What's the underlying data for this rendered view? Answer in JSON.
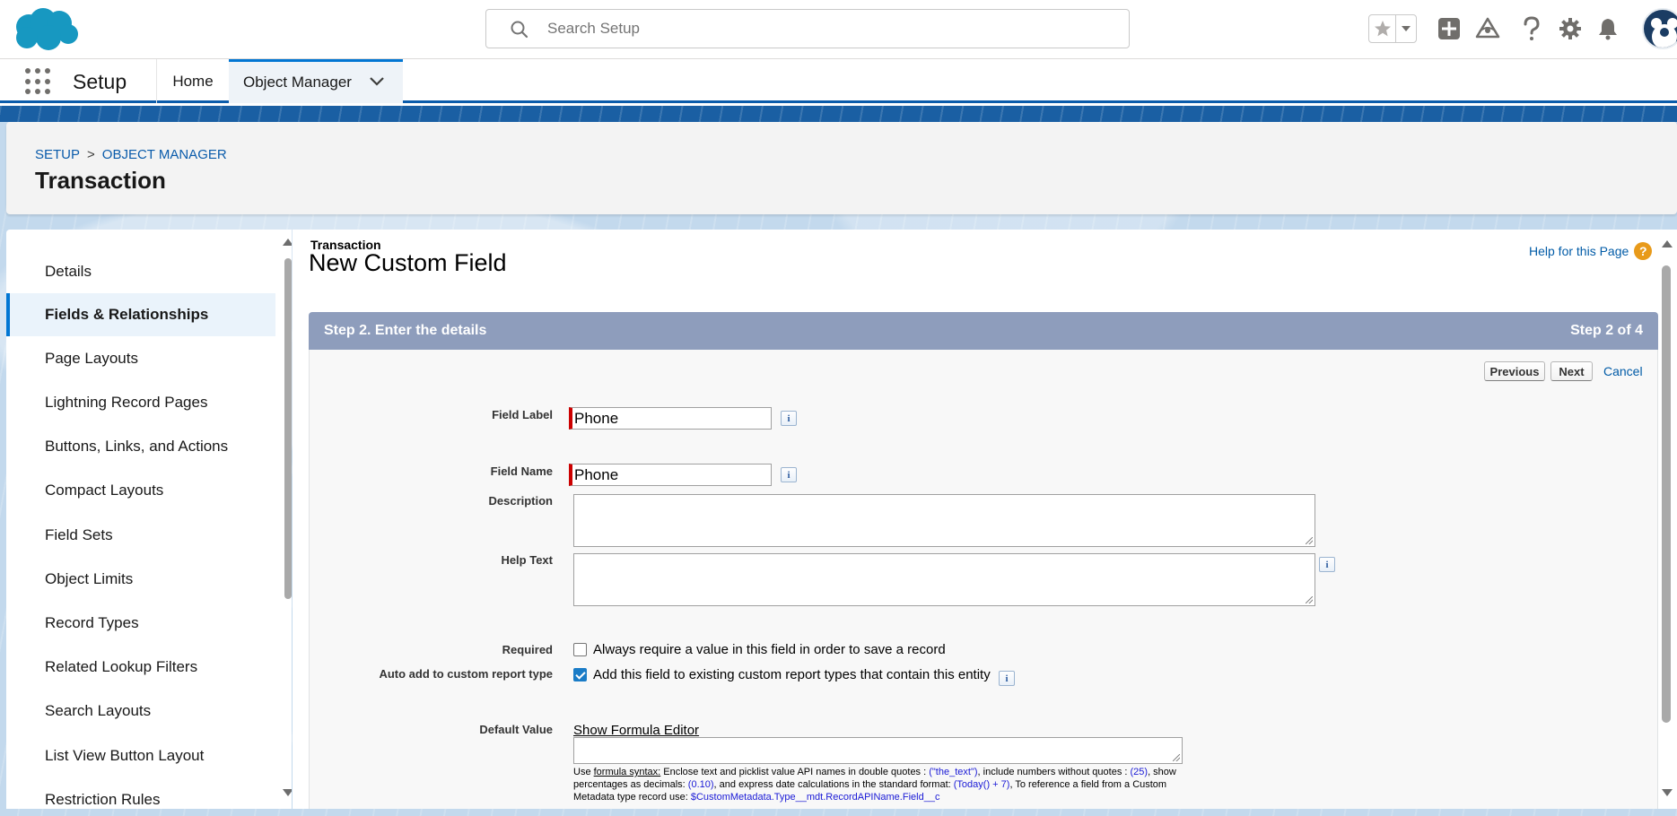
{
  "header": {
    "search_placeholder": "Search Setup",
    "icons": [
      "favorites-star-icon",
      "favorites-menu-icon",
      "add-icon",
      "trailhead-icon",
      "help-icon",
      "gear-icon",
      "notification-bell-icon",
      "avatar"
    ]
  },
  "nav": {
    "app_name": "Setup",
    "tabs": [
      {
        "label": "Home"
      },
      {
        "label": "Object Manager"
      }
    ]
  },
  "page_header": {
    "breadcrumb": [
      "SETUP",
      ">",
      "OBJECT MANAGER"
    ],
    "title": "Transaction"
  },
  "sidebar": {
    "items": [
      {
        "label": "Details"
      },
      {
        "label": "Fields & Relationships",
        "active": true
      },
      {
        "label": "Page Layouts"
      },
      {
        "label": "Lightning Record Pages"
      },
      {
        "label": "Buttons, Links, and Actions"
      },
      {
        "label": "Compact Layouts"
      },
      {
        "label": "Field Sets"
      },
      {
        "label": "Object Limits"
      },
      {
        "label": "Record Types"
      },
      {
        "label": "Related Lookup Filters"
      },
      {
        "label": "Search Layouts"
      },
      {
        "label": "List View Button Layout"
      },
      {
        "label": "Restriction Rules"
      }
    ]
  },
  "main": {
    "object_label": "Transaction",
    "title": "New Custom Field",
    "help_link": "Help for this Page",
    "help_icon_glyph": "?",
    "step_title": "Step 2. Enter the details",
    "step_count": "Step 2 of 4",
    "buttons": {
      "previous": "Previous",
      "next": "Next",
      "cancel": "Cancel"
    },
    "fields": {
      "field_label": {
        "label": "Field Label",
        "value": "Phone"
      },
      "field_name": {
        "label": "Field Name",
        "value": "Phone"
      },
      "description": {
        "label": "Description",
        "value": ""
      },
      "help_text": {
        "label": "Help Text",
        "value": ""
      },
      "required": {
        "label": "Required",
        "checkbox_label": "Always require a value in this field in order to save a record",
        "checked": false
      },
      "auto_add": {
        "label": "Auto add to custom report type",
        "checkbox_label": "Add this field to existing custom report types that contain this entity",
        "checked": true
      },
      "default_value": {
        "label": "Default Value",
        "link": "Show Formula Editor",
        "value": ""
      }
    },
    "info_glyph": "i",
    "formula_help": {
      "use": "Use ",
      "formula_syntax": "formula syntax:",
      "p1": " Enclose text and picklist value API names in double quotes : ",
      "ex1": "(\"the_text\")",
      "p2": ", include numbers without quotes : ",
      "ex2": "(25)",
      "p3": ", show percentages as decimals: ",
      "ex3": "(0.10)",
      "p4": ", and express date calculations in the standard format: ",
      "ex4": "(Today() + 7)",
      "p5": ", To reference a field from a Custom Metadata type record use: ",
      "ex5": "$CustomMetadata.Type__mdt.RecordAPIName.Field__c"
    }
  },
  "colors": {
    "brand_blue": "#0176d3",
    "header_band": "#1a5fa3",
    "step_bar": "#8e9dbc",
    "required_marker": "#cc0000",
    "link": "#015ba7"
  }
}
